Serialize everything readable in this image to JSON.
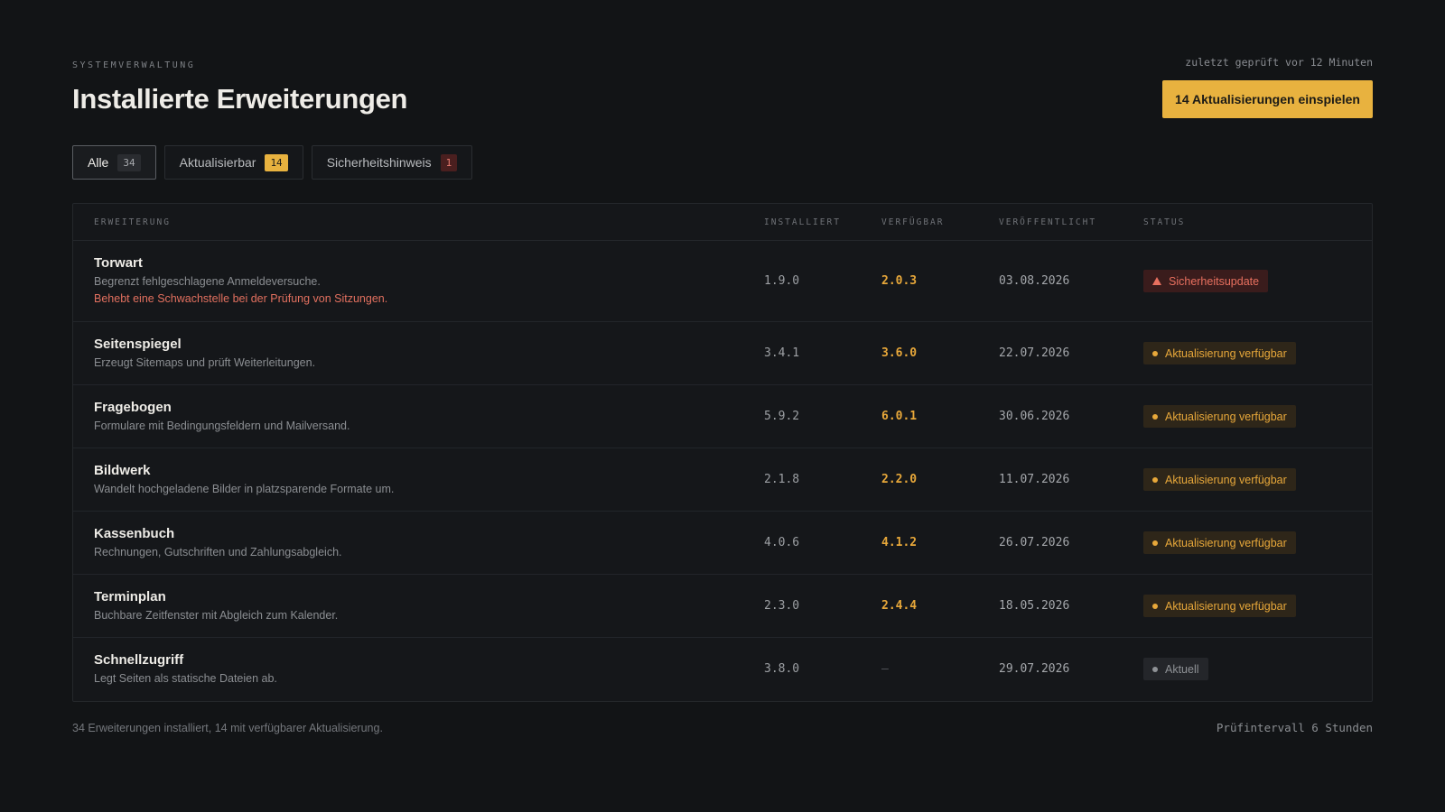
{
  "header": {
    "eyebrow": "SYSTEMVERWALTUNG",
    "title": "Installierte Erweiterungen",
    "last_checked": "zuletzt geprüft vor 12 Minuten",
    "primary_action": "14 Aktualisierungen einspielen"
  },
  "tabs": [
    {
      "label": "Alle",
      "count": "34"
    },
    {
      "label": "Aktualisierbar",
      "count": "14"
    },
    {
      "label": "Sicherheitshinweis",
      "count": "1"
    }
  ],
  "table": {
    "columns": [
      "ERWEITERUNG",
      "INSTALLIERT",
      "VERFÜGBAR",
      "VERÖFFENTLICHT",
      "STATUS"
    ],
    "rows": [
      {
        "name": "Torwart",
        "desc": "Begrenzt fehlgeschlagene Anmeldeversuche.",
        "note": "Behebt eine Schwachstelle bei der Prüfung von Sitzungen.",
        "installed": "1.9.0",
        "available": "2.0.3",
        "published": "03.08.2026",
        "status": "Sicherheitsupdate",
        "status_type": "security"
      },
      {
        "name": "Seitenspiegel",
        "desc": "Erzeugt Sitemaps und prüft Weiterleitungen.",
        "installed": "3.4.1",
        "available": "3.6.0",
        "published": "22.07.2026",
        "status": "Aktualisierung verfügbar",
        "status_type": "update"
      },
      {
        "name": "Fragebogen",
        "desc": "Formulare mit Bedingungsfeldern und Mailversand.",
        "installed": "5.9.2",
        "available": "6.0.1",
        "published": "30.06.2026",
        "status": "Aktualisierung verfügbar",
        "status_type": "update"
      },
      {
        "name": "Bildwerk",
        "desc": "Wandelt hochgeladene Bilder in platzsparende Formate um.",
        "installed": "2.1.8",
        "available": "2.2.0",
        "published": "11.07.2026",
        "status": "Aktualisierung verfügbar",
        "status_type": "update"
      },
      {
        "name": "Kassenbuch",
        "desc": "Rechnungen, Gutschriften und Zahlungsabgleich.",
        "installed": "4.0.6",
        "available": "4.1.2",
        "published": "26.07.2026",
        "status": "Aktualisierung verfügbar",
        "status_type": "update"
      },
      {
        "name": "Terminplan",
        "desc": "Buchbare Zeitfenster mit Abgleich zum Kalender.",
        "installed": "2.3.0",
        "available": "2.4.4",
        "published": "18.05.2026",
        "status": "Aktualisierung verfügbar",
        "status_type": "update"
      },
      {
        "name": "Schnellzugriff",
        "desc": "Legt Seiten als statische Dateien ab.",
        "installed": "3.8.0",
        "available": "—",
        "published": "29.07.2026",
        "status": "Aktuell",
        "status_type": "current"
      }
    ]
  },
  "footer": {
    "summary": "34 Erweiterungen installiert, 14 mit verfügbarer Aktualisierung.",
    "interval": "Prüfintervall 6 Stunden"
  },
  "colors": {
    "accent": "#e8b23f",
    "danger": "#e8705f",
    "background": "#121416"
  }
}
